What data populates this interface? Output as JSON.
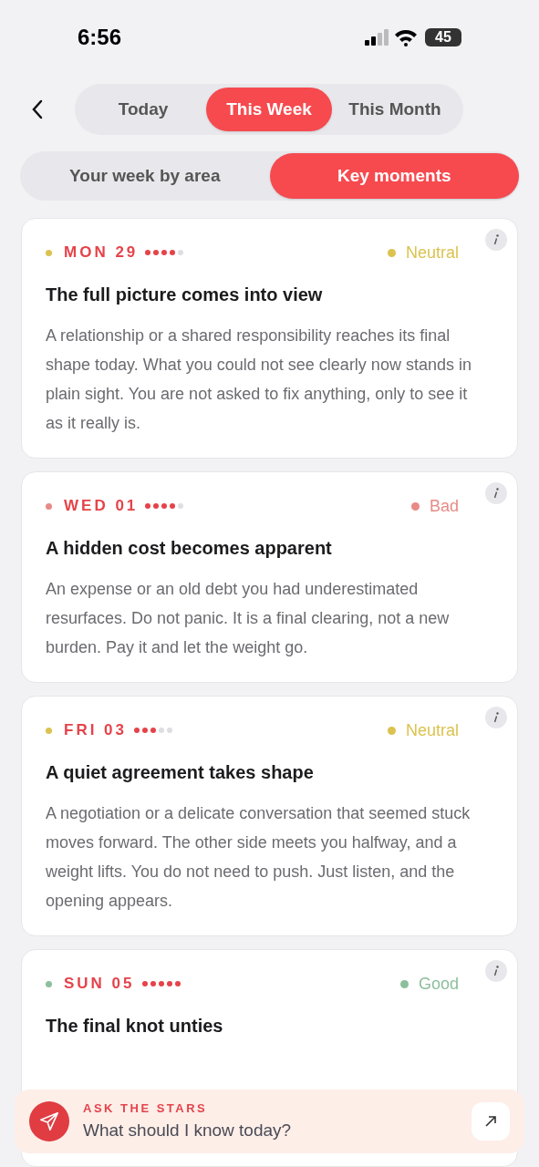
{
  "status_bar": {
    "time": "6:56",
    "battery": "45"
  },
  "period_tabs": [
    {
      "label": "Today",
      "selected": false
    },
    {
      "label": "This Week",
      "selected": true
    },
    {
      "label": "This Month",
      "selected": false
    }
  ],
  "view_tabs": [
    {
      "label": "Your week by area",
      "selected": false
    },
    {
      "label": "Key moments",
      "selected": true
    }
  ],
  "moments": [
    {
      "date": "MON 29",
      "stars": 4,
      "mood": "Neutral",
      "color": "#dcc24f",
      "title": "The full picture comes into view",
      "body": "A relationship or a shared responsibility reaches its final shape today. What you could not see clearly now stands in plain sight. You are not asked to fix anything, only to see it as it really is."
    },
    {
      "date": "WED 01",
      "stars": 4,
      "mood": "Bad",
      "color": "#e88a86",
      "title": "A hidden cost becomes apparent",
      "body": "An expense or an old debt you had underestimated resurfaces. Do not panic. It is a final clearing, not a new burden. Pay it and let the weight go."
    },
    {
      "date": "FRI 03",
      "stars": 3,
      "mood": "Neutral",
      "color": "#dcc24f",
      "title": "A quiet agreement takes shape",
      "body": "A negotiation or a delicate conversation that seemed stuck moves forward. The other side meets you halfway, and a weight lifts. You do not need to push. Just listen, and the opening appears."
    },
    {
      "date": "SUN 05",
      "stars": 5,
      "mood": "Good",
      "color": "#8cbf9c",
      "title": "The final knot unties"
    }
  ],
  "ask_bar": {
    "label": "ASK THE STARS",
    "prompt": "What should I know today?"
  }
}
